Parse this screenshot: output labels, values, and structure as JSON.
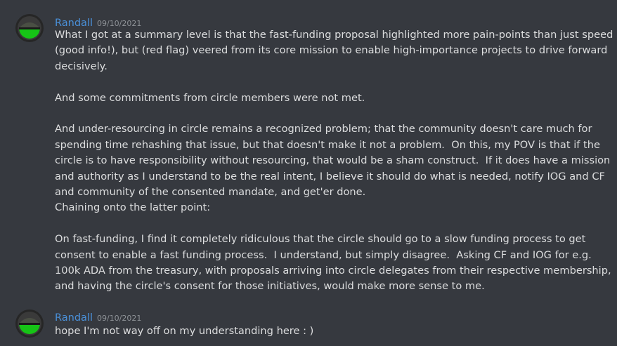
{
  "messages": [
    {
      "author": "Randall",
      "timestamp": "09/10/2021",
      "avatar_icon": "user-avatar-green-helmet",
      "paragraphs": [
        "What I got at a summary level is that the fast-funding proposal highlighted more pain-points than just speed (good info!), but (red flag) veered from its core mission to enable high-importance projects to drive forward decisively.",
        "And some commitments from circle members were not met.",
        "And under-resourcing in circle remains a recognized problem; that the community doesn't care much for spending time rehashing that issue, but that doesn't make it not a problem.  On this, my POV is that if the circle is to have responsibility without resourcing, that would be a sham construct.  If it does have a mission and authority as I understand to be the real intent, I believe it should do what is needed, notify IOG and CF and community of the consented mandate, and get'er done.",
        "Chaining onto the latter point:",
        "On fast-funding, I find it completely ridiculous that the circle should go to a slow funding process to get consent to enable a fast funding process.  I understand, but simply disagree.  Asking CF and IOG for e.g. 100k ADA from the treasury, with proposals arriving into circle delegates from their respective membership, and having the circle's consent for those initiatives, would make more sense to me."
      ]
    },
    {
      "author": "Randall",
      "timestamp": "09/10/2021",
      "avatar_icon": "user-avatar-green-helmet",
      "paragraphs": [
        "hope I'm not way off on my understanding here : )"
      ]
    }
  ],
  "colors": {
    "background": "#36393f",
    "username": "#4a90d9",
    "text": "#dcddde",
    "timestamp": "#8e9297"
  }
}
